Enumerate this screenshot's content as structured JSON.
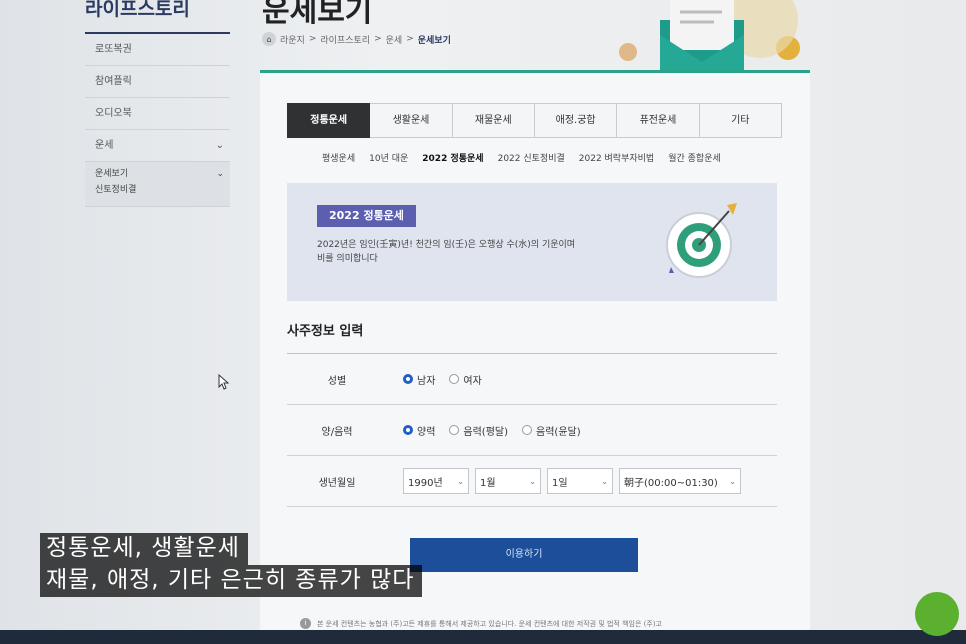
{
  "sidebar": {
    "title": "라이프스토리",
    "items": [
      {
        "label": "로또복권"
      },
      {
        "label": "참여플릭"
      },
      {
        "label": "오디오북"
      },
      {
        "label": "운세"
      }
    ],
    "sub_items": [
      {
        "label": "운세보기"
      },
      {
        "label": "신토정비결"
      }
    ]
  },
  "header": {
    "title": "운세보기",
    "breadcrumb": [
      "라운지",
      "라이프스토리",
      "운세",
      "운세보기"
    ],
    "breadcrumb_sep": ">"
  },
  "tabs": [
    {
      "label": "정통운세",
      "active": true
    },
    {
      "label": "생활운세"
    },
    {
      "label": "재물운세"
    },
    {
      "label": "애정.궁합"
    },
    {
      "label": "퓨전운세"
    },
    {
      "label": "기타"
    }
  ],
  "subtabs": [
    {
      "label": "평생운세"
    },
    {
      "label": "10년 대운"
    },
    {
      "label": "2022 정통운세",
      "active": true
    },
    {
      "label": "2022 신토정비결"
    },
    {
      "label": "2022 벼락부자비법"
    },
    {
      "label": "월간 종합운세"
    }
  ],
  "banner": {
    "badge": "2022 정통운세",
    "desc_line1": "2022년은 임인(壬寅)년! 천간의 임(壬)은 오행상 수(水)의 기운이며",
    "desc_line2": "비를 의미합니다"
  },
  "form": {
    "title": "사주정보 입력",
    "gender": {
      "label": "성별",
      "options": [
        "남자",
        "여자"
      ],
      "selected": "남자"
    },
    "calendar": {
      "label": "양/음력",
      "options": [
        "양력",
        "음력(평달)",
        "음력(윤달)"
      ],
      "selected": "양력"
    },
    "birth": {
      "label": "생년월일",
      "year": "1990년",
      "month": "1월",
      "day": "1일",
      "hour": "朝子(00:00~01:30)"
    }
  },
  "submit_label": "이용하기",
  "notice": "본 운세 컨텐츠는 농협과 (주)고든 제휴를 통해서 제공하고 있습니다. 운세 컨텐츠에 대한 저작권 및 법적 책임은 (주)고",
  "caption": {
    "line1": "정통운세, 생활운세",
    "line2": "재물, 애정, 기타 은근히 종류가 많다"
  },
  "colors": {
    "accent": "#2aa38a",
    "primary": "#1d4e9a",
    "badge": "#5c5fb0",
    "active_tab": "#2f3133"
  }
}
